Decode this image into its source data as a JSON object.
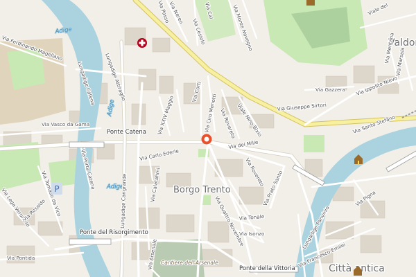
{
  "map": {
    "rivers": {
      "name": "Adige"
    },
    "bridges": {
      "catena": "Ponte Catena",
      "risorgimento": "Ponte del Risorgimento",
      "vittoria": "Ponte della Vittoria"
    },
    "districts": {
      "borgo_trento": "Borgo Trento",
      "valdonega": "Valdon",
      "citta_antica": "Città antica"
    },
    "pois": {
      "arsenale": "Cantiere dell'Arsenale"
    },
    "streets": {
      "ferdinando_magellano": "Via Ferdinando Magellano",
      "lungadige_attiraglio": "Lungadige Attiraglio",
      "lungadige_catena": "Lungadige Catena",
      "vasco_da_gama": "Via Vasco da Gama",
      "porta_catena": "Via Porta Catena",
      "tomaso_da_vico": "Via Tomaso da Vico",
      "lega_veronese": "Via Lega Veronese",
      "rosaldo": "Via Rosaldo",
      "pontida": "Via Pontida",
      "lungadige_cangrande": "Lungadige Cangrande",
      "carlo_ederle": "Via Carlo Ederle",
      "calatafimi": "Via Calatafimi",
      "arsenale": "Via Arsenale",
      "xxiv_maggio": "Via XXIV Maggio",
      "cesiolo": "Via Cesiolo",
      "corti": "Via Corti",
      "ciro_menotti": "Via Ciro Menotti",
      "rovereto": "Via Rovereto",
      "nino_bixio": "Viale Nino Bixio",
      "dei_mille": "Via dei Mille",
      "quattro_novembre": "Via Quattro Novembre",
      "prato_santo": "Via Prato Santo",
      "tonale": "Via Tonale",
      "isonzo": "Via Isonzo",
      "giuseppe_sirtori": "Via Giuseppe Sirtori",
      "santo_stefano": "Via Santo Stefano",
      "ippolito_nievo": "Via Ippolito Nievo",
      "gazzera": "Via Gazzera",
      "mentana": "Via Mentana",
      "marsala": "Via Marsala",
      "lungadige_panvinio": "Lungadige Panvinio",
      "francesco_emilei": "Via Francesco Emilei",
      "pigna": "Via Pigna",
      "nievo_upper": "Via Nievo",
      "passo": "Via Passo",
      "nereo": "Via Nereo",
      "monte_novegno": "Via Monte Novegno",
      "cal": "Via Cal",
      "viale_del": "Viale del"
    }
  },
  "colors": {
    "background": "#f2efe9",
    "water": "#aad3df",
    "park": "#c8e8b4",
    "park_dark": "#add19e",
    "building": "#ddd6cb",
    "road_major": "#f7f0a0",
    "road_major_casing": "#d4c260",
    "road_minor": "#ffffff",
    "hospital_red": "#b3001b",
    "marker": "#e8512c",
    "church_brown": "#9a6a2a"
  },
  "icons": {
    "hospital": "hospital-cross-icon",
    "marker": "location-pin-icon",
    "church": "church-icon",
    "parking": "parking-icon",
    "castle": "castle-icon"
  }
}
